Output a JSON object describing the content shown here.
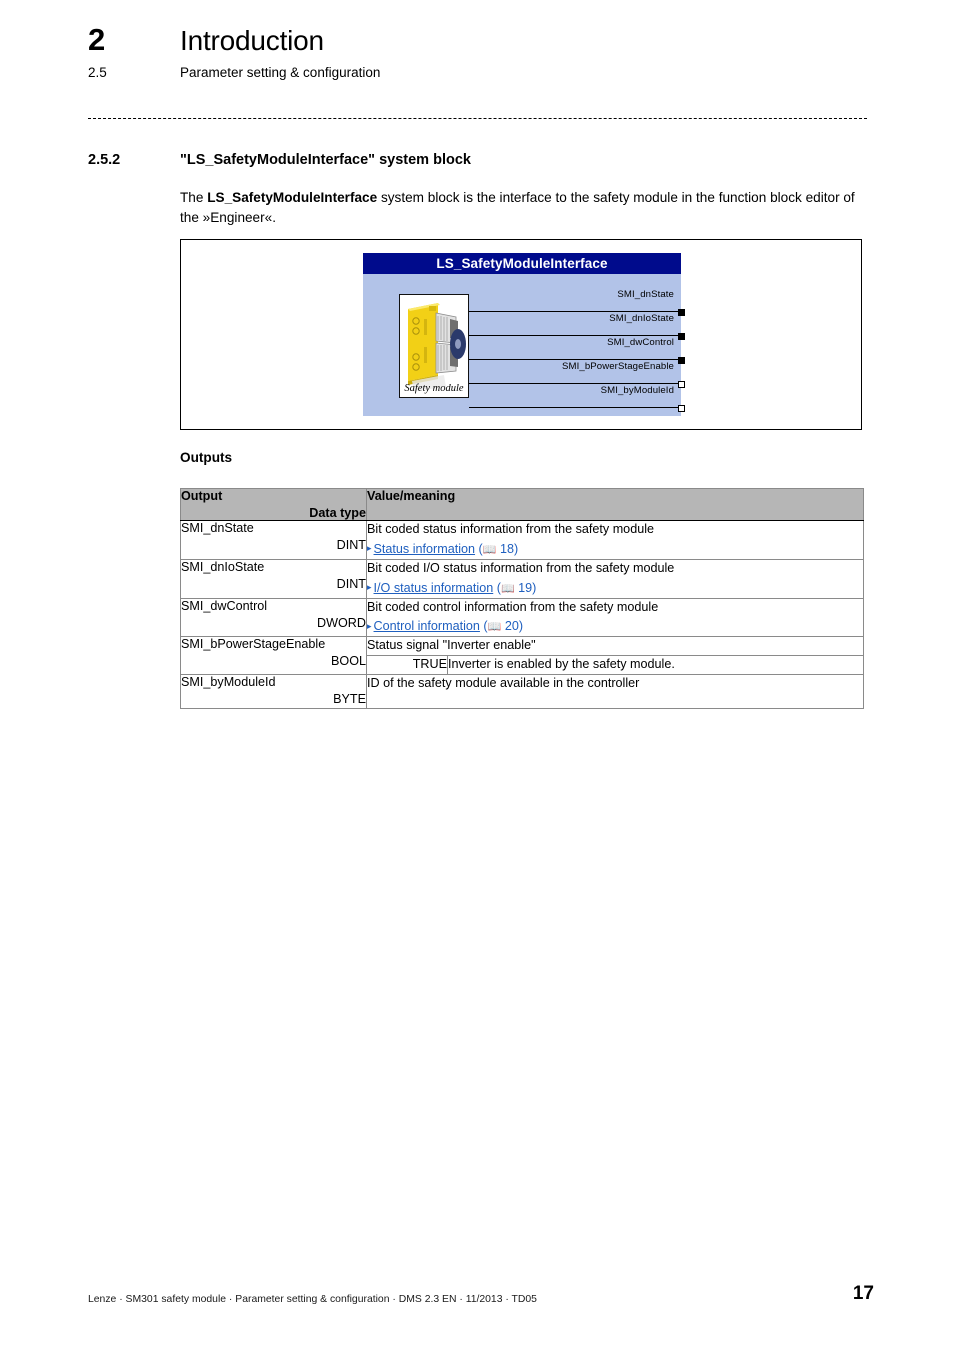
{
  "header": {
    "chapter_number": "2",
    "chapter_title": "Introduction",
    "section_number": "2.5",
    "section_title": "Parameter setting & configuration"
  },
  "subsection": {
    "number": "2.5.2",
    "title": "\"LS_SafetyModuleInterface\" system block",
    "intro_before": "The ",
    "intro_bold": "LS_SafetyModuleInterface",
    "intro_after": " system block is the interface to the safety module in the function block editor of the »Engineer«."
  },
  "diagram": {
    "block_title": "LS_SafetyModuleInterface",
    "image_caption": "Safety module",
    "colors": {
      "title_bar": "#000b8c",
      "body": "#b2c3e8"
    },
    "pins": [
      {
        "label": "SMI_dnState",
        "marker": "filled"
      },
      {
        "label": "SMI_dnIoState",
        "marker": "filled"
      },
      {
        "label": "SMI_dwControl",
        "marker": "filled"
      },
      {
        "label": "SMI_bPowerStageEnable",
        "marker": "hollow"
      },
      {
        "label": "SMI_byModuleId",
        "marker": "hollow"
      }
    ]
  },
  "outputs": {
    "heading": "Outputs",
    "columns": {
      "output": "Output",
      "data_type": "Data type",
      "value_meaning": "Value/meaning"
    },
    "rows": [
      {
        "name": "SMI_dnState",
        "data_type": "DINT",
        "description": "Bit coded status information from the safety module",
        "xref_label": "Status information",
        "xref_page": "18"
      },
      {
        "name": "SMI_dnIoState",
        "data_type": "DINT",
        "description": "Bit coded I/O status information from the safety module",
        "xref_label": "I/O status information",
        "xref_page": "19"
      },
      {
        "name": "SMI_dwControl",
        "data_type": "DWORD",
        "description": "Bit coded control information from the safety module",
        "xref_label": "Control information",
        "xref_page": "20"
      },
      {
        "name": "SMI_bPowerStageEnable",
        "data_type": "BOOL",
        "description": "Status signal \"Inverter enable\"",
        "sub_value": "TRUE",
        "sub_meaning": "Inverter is enabled by the safety module."
      },
      {
        "name": "SMI_byModuleId",
        "data_type": "BYTE",
        "description": "ID of the safety module available in the controller"
      }
    ]
  },
  "footer": {
    "text": "Lenze · SM301 safety module · Parameter setting & configuration · DMS 2.3 EN · 11/2013 · TD05",
    "page_number": "17"
  }
}
